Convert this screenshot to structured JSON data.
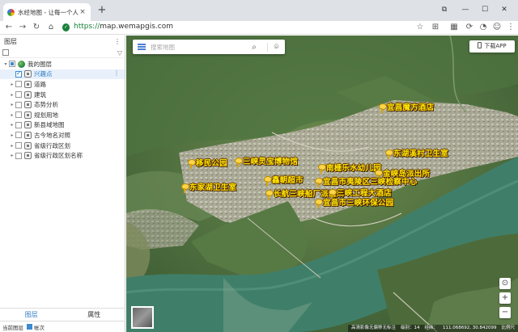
{
  "browser": {
    "tab_title": "水经地图 - 让每一个人都有自己",
    "tab_close": "×",
    "new_tab": "+",
    "url_protocol": "https://",
    "url_host": "map.wemapgis.com"
  },
  "panel": {
    "title": "图层",
    "menu": "⋮",
    "layers": [
      {
        "label": "我的图层",
        "checked": "partial",
        "expanded": true,
        "level": 0
      },
      {
        "label": "兴趣点",
        "checked": "checked",
        "level": 1,
        "selected": true
      },
      {
        "label": "道路",
        "checked": "none",
        "level": 1
      },
      {
        "label": "建筑",
        "checked": "none",
        "level": 1
      },
      {
        "label": "态势分析",
        "checked": "none",
        "level": 1
      },
      {
        "label": "规划用地",
        "checked": "none",
        "level": 1
      },
      {
        "label": "新县域地图",
        "checked": "none",
        "level": 1
      },
      {
        "label": "古今地名对照",
        "checked": "none",
        "level": 1
      },
      {
        "label": "省级行政区划",
        "checked": "none",
        "level": 1
      },
      {
        "label": "省级行政区划名称",
        "checked": "none",
        "level": 1
      }
    ],
    "tabs": [
      {
        "label": "图层",
        "active": true
      },
      {
        "label": "属性",
        "active": false
      }
    ],
    "status_label": "当前图层",
    "status_value": "帐次"
  },
  "map": {
    "search_placeholder": "搜索地图",
    "app_button": "下载APP",
    "pois": [
      {
        "label": "宜昌魔方酒店"
      },
      {
        "label": "东湖溪村卫生室"
      },
      {
        "label": "移民公园"
      },
      {
        "label": "三峡灵宝博物馆"
      },
      {
        "label": "南栅乐水幼儿园"
      },
      {
        "label": "金峡岛派出所"
      },
      {
        "label": "鑫朝超市"
      },
      {
        "label": "宜昌市夷陵区三峡检察中心"
      },
      {
        "label": "东家湖卫生室"
      },
      {
        "label": "长航三峡船厂派出所"
      },
      {
        "label": "三峡工程大酒店"
      },
      {
        "label": "宜昌市三峡环保公园"
      }
    ],
    "status_bar": [
      "高清影像无偏移无标注",
      "",
      "级别：14",
      "经纬：",
      "111.068692, 30.842099",
      "比例尺"
    ],
    "zoom_in": "+",
    "zoom_out": "−"
  },
  "colors": {
    "accent": "#2b7bc4",
    "poi_label": "#ffe600",
    "river": "#3f7f6a"
  }
}
